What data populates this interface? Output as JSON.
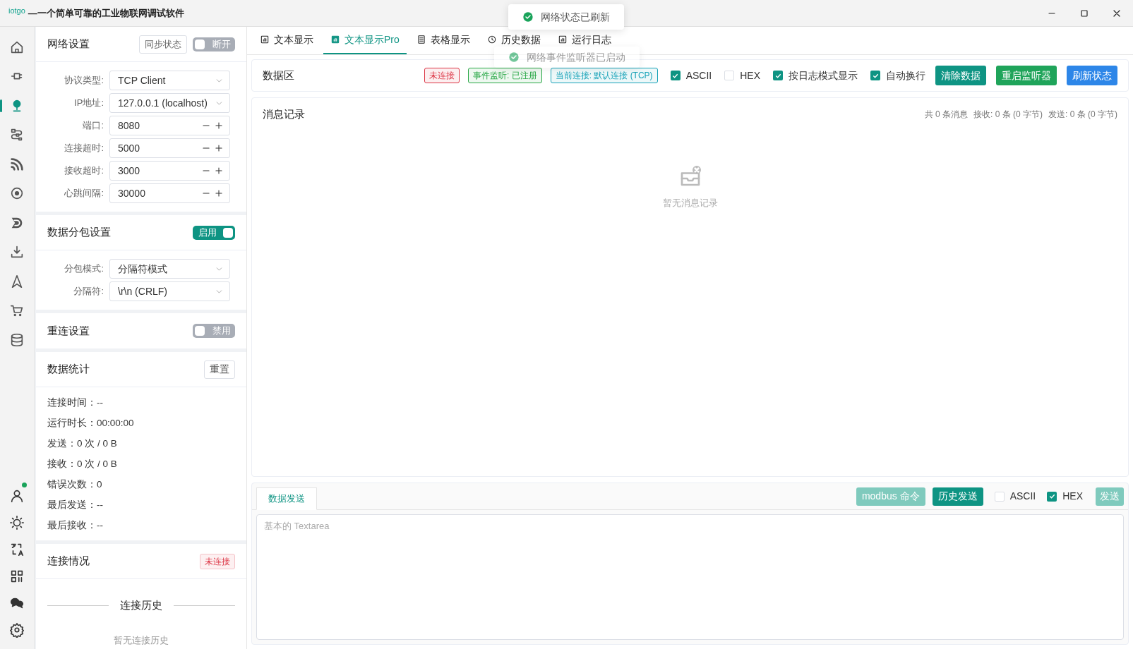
{
  "window": {
    "logo": "iotgo",
    "title": "—一个简单可靠的工业物联网调试软件"
  },
  "rail_top": [
    {
      "selected": false
    },
    {
      "selected": false
    },
    {
      "selected": true
    },
    {
      "selected": false
    },
    {
      "selected": false
    },
    {
      "selected": false
    },
    {
      "selected": false
    },
    {
      "selected": false
    },
    {
      "selected": false
    },
    {
      "selected": false
    },
    {
      "selected": false
    }
  ],
  "rail_bottom": [
    {
      "dot": true
    },
    {
      "dot": false
    },
    {
      "dot": false
    },
    {
      "dot": false
    },
    {
      "dot": false
    },
    {
      "dot": false
    }
  ],
  "network_settings": {
    "title": "网络设置",
    "sync_button": "同步状态",
    "toggle": {
      "label": "断开",
      "on": false
    },
    "fields": [
      {
        "label": "协议类型:",
        "value": "TCP Client",
        "kind": "select"
      },
      {
        "label": "IP地址:",
        "value": "127.0.0.1 (localhost)",
        "kind": "select"
      },
      {
        "label": "端口:",
        "value": "8080",
        "kind": "number"
      },
      {
        "label": "连接超时:",
        "value": "5000",
        "kind": "number"
      },
      {
        "label": "接收超时:",
        "value": "3000",
        "kind": "number"
      },
      {
        "label": "心跳间隔:",
        "value": "30000",
        "kind": "number"
      }
    ]
  },
  "packet_settings": {
    "title": "数据分包设置",
    "toggle": {
      "label": "启用",
      "on": true
    },
    "fields": [
      {
        "label": "分包模式:",
        "value": "分隔符模式",
        "kind": "select"
      },
      {
        "label": "分隔符:",
        "value": "\\r\\n (CRLF)",
        "kind": "select"
      }
    ]
  },
  "reconnect_settings": {
    "title": "重连设置",
    "toggle": {
      "label": "禁用",
      "on": false
    }
  },
  "statistics": {
    "title": "数据统计",
    "reset_button": "重置",
    "lines": [
      "连接时间：--",
      "运行时长：00:00:00",
      "发送：0 次 / 0 B",
      "接收：0 次 / 0 B",
      "错误次数：0",
      "最后发送：--",
      "最后接收：--"
    ]
  },
  "connection": {
    "title": "连接情况",
    "badge": "未连接",
    "history_title": "连接历史",
    "history_empty": "暂无连接历史"
  },
  "tabs": [
    {
      "label": "文本显示",
      "selected": false
    },
    {
      "label": "文本显示Pro",
      "selected": true
    },
    {
      "label": "表格显示",
      "selected": false
    },
    {
      "label": "历史数据",
      "selected": false
    },
    {
      "label": "运行日志",
      "selected": false
    }
  ],
  "toasts": [
    {
      "text": "网络状态已刷新",
      "faded": false
    },
    {
      "text": "网络事件监听器已启动",
      "faded": true
    }
  ],
  "data_area": {
    "title": "数据区",
    "tags": [
      {
        "text": "未连接",
        "color": "#dc3545"
      },
      {
        "text": "事件监听: 已注册",
        "color": "#28a745"
      },
      {
        "text": "当前连接: 默认连接 (TCP)",
        "color": "#17a2b8"
      }
    ],
    "checkboxes": [
      {
        "label": "ASCII",
        "checked": true
      },
      {
        "label": "HEX",
        "checked": false
      },
      {
        "label": "按日志模式显示",
        "checked": true
      },
      {
        "label": "自动换行",
        "checked": true
      }
    ],
    "buttons": [
      {
        "label": "清除数据",
        "color": "#0e9483"
      },
      {
        "label": "重启监听器",
        "color": "#1fa45a"
      },
      {
        "label": "刷新状态",
        "color": "#2d86e8"
      }
    ]
  },
  "messages": {
    "title": "消息记录",
    "summary": [
      "共 0 条消息",
      "接收: 0 条 (0 字节)",
      "发送: 0 条 (0 字节)"
    ],
    "empty": "暂无消息记录"
  },
  "send": {
    "tab": "数据发送",
    "buttons": [
      {
        "label": "modbus 命令",
        "disabled": true
      },
      {
        "label": "历史发送",
        "disabled": false
      }
    ],
    "checkboxes": [
      {
        "label": "ASCII",
        "checked": false
      },
      {
        "label": "HEX",
        "checked": true
      }
    ],
    "send_button": {
      "label": "发送",
      "disabled": true
    },
    "placeholder": "基本的 Textarea"
  }
}
